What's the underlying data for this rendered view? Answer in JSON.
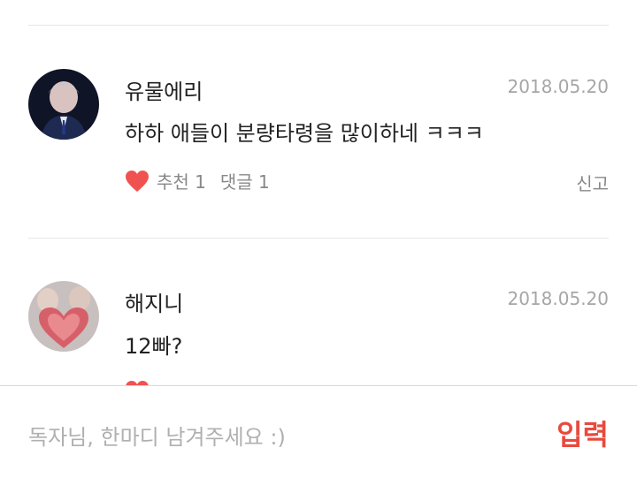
{
  "comments": [
    {
      "nickname": "유물에리",
      "date": "2018.05.20",
      "text": "하하 애들이 분량타령을 많이하네 ㅋㅋㅋ",
      "like_label": "추천 1",
      "reply_label": "댓글 1",
      "report_label": "신고"
    },
    {
      "nickname": "해지니",
      "date": "2018.05.20",
      "text": "12빠?"
    }
  ],
  "input": {
    "placeholder": "독자님, 한마디 남겨주세요 :)",
    "submit_label": "입력"
  },
  "colors": {
    "accent": "#e84a3e",
    "heart": "#f05252"
  },
  "icons": [
    "heart-icon"
  ]
}
